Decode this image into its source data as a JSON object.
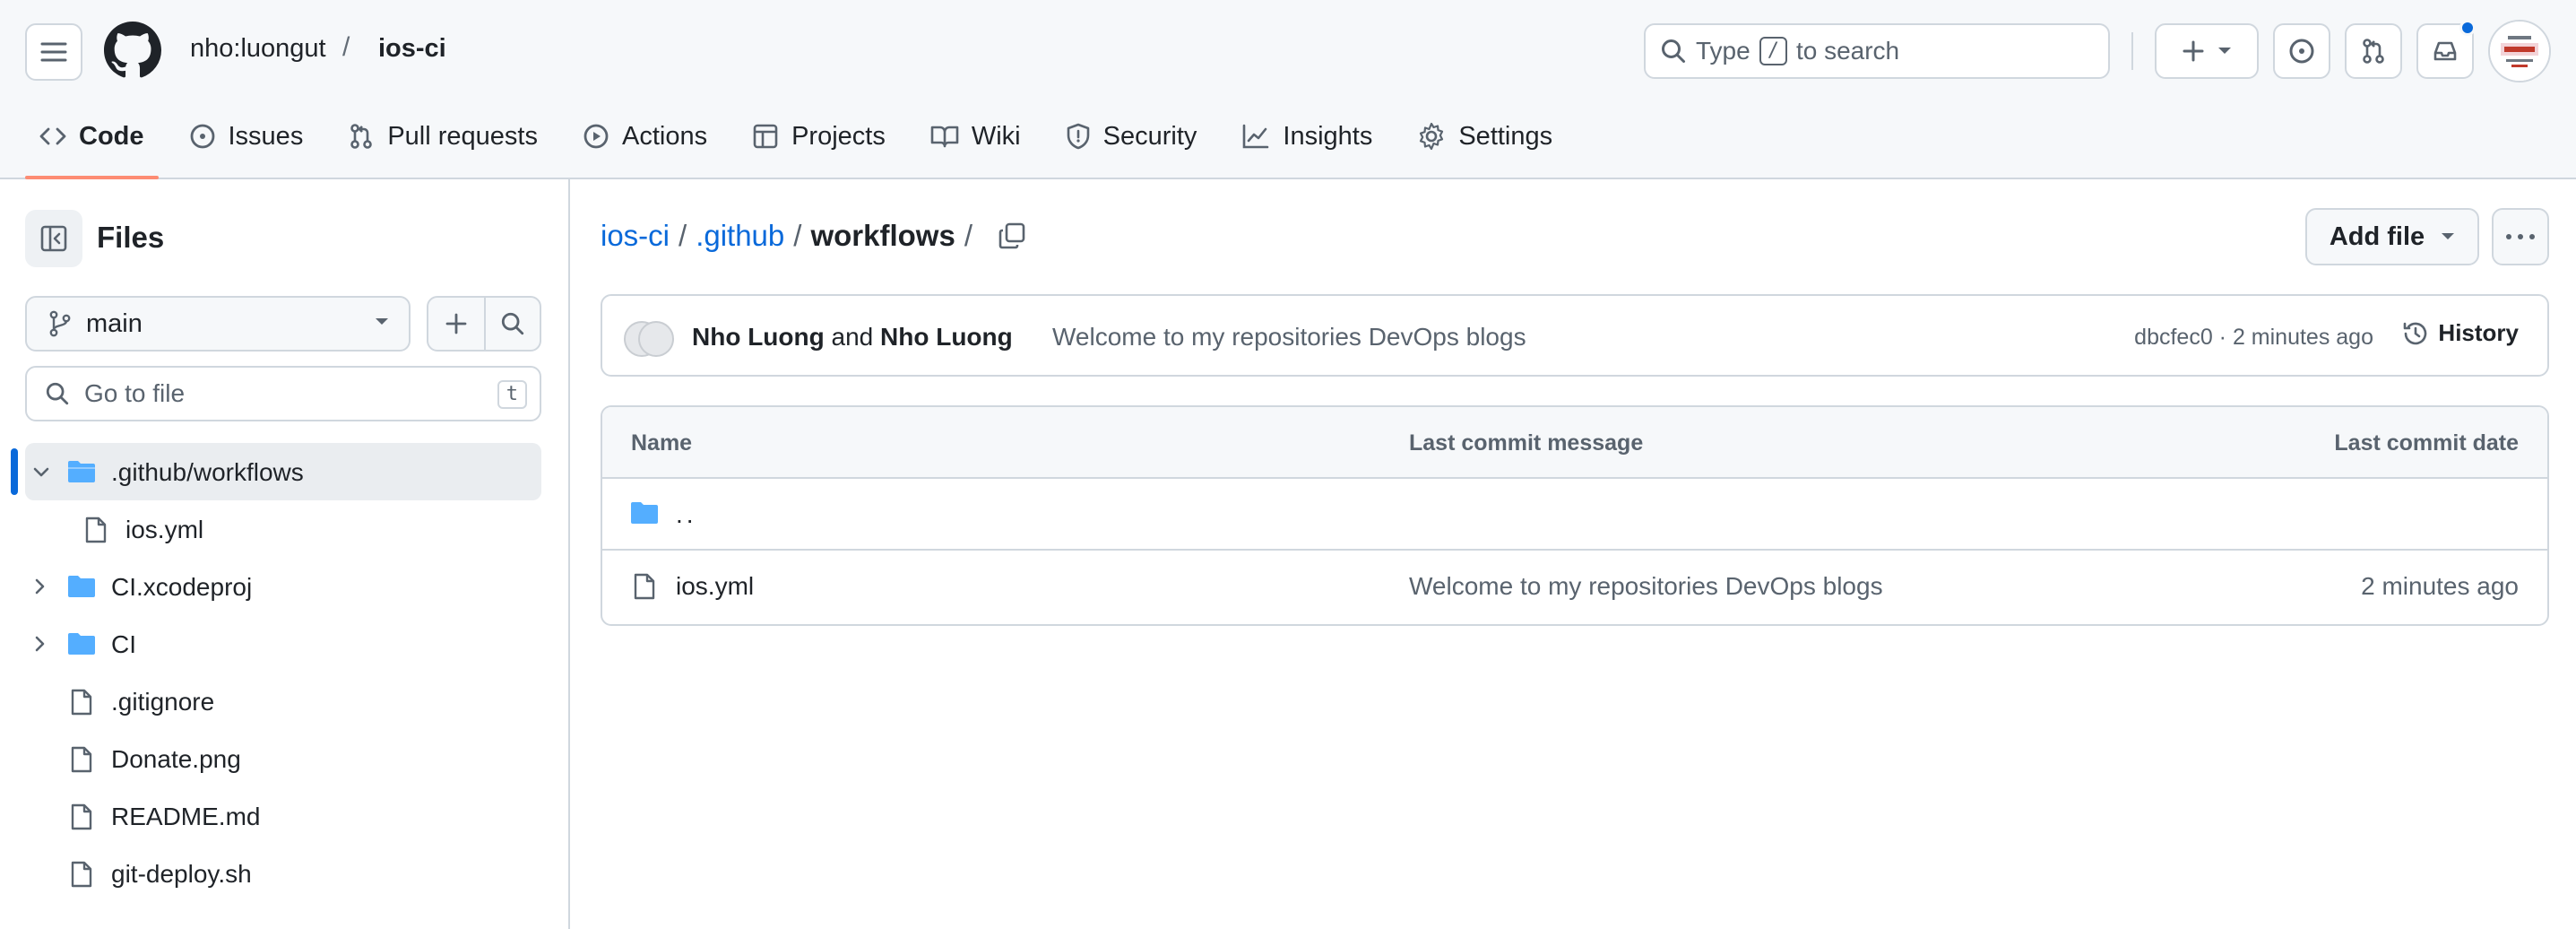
{
  "header": {
    "owner": "nho:luongut",
    "separator": "/",
    "repo": "ios-ci",
    "search_prefix": "Type",
    "search_key": "/",
    "search_suffix": "to search"
  },
  "nav": {
    "code": "Code",
    "issues": "Issues",
    "pulls": "Pull requests",
    "actions": "Actions",
    "projects": "Projects",
    "wiki": "Wiki",
    "security": "Security",
    "insights": "Insights",
    "settings": "Settings"
  },
  "sidebar": {
    "title": "Files",
    "branch": "main",
    "goto_placeholder": "Go to file",
    "goto_key": "t",
    "tree": [
      {
        "label": ".github/workflows"
      },
      {
        "label": "ios.yml"
      },
      {
        "label": "CI.xcodeproj"
      },
      {
        "label": "CI"
      },
      {
        "label": ".gitignore"
      },
      {
        "label": "Donate.png"
      },
      {
        "label": "README.md"
      },
      {
        "label": "git-deploy.sh"
      }
    ]
  },
  "main": {
    "path": {
      "root": "ios-ci",
      "dir": ".github",
      "current": "workflows",
      "sep": "/"
    },
    "add_file": "Add file",
    "commit": {
      "author1": "Nho Luong",
      "and": "and",
      "author2": "Nho Luong",
      "message": "Welcome to my repositories DevOps blogs",
      "meta": "dbcfec0 · 2 minutes ago",
      "history": "History"
    },
    "table": {
      "col_name": "Name",
      "col_msg": "Last commit message",
      "col_date": "Last commit date",
      "parent": "..",
      "rows": [
        {
          "name": "ios.yml",
          "message": "Welcome to my repositories DevOps blogs",
          "date": "2 minutes ago"
        }
      ]
    }
  },
  "colors": {
    "accent": "#0969da",
    "folder": "#54aeff",
    "underline": "#fd8c73"
  }
}
